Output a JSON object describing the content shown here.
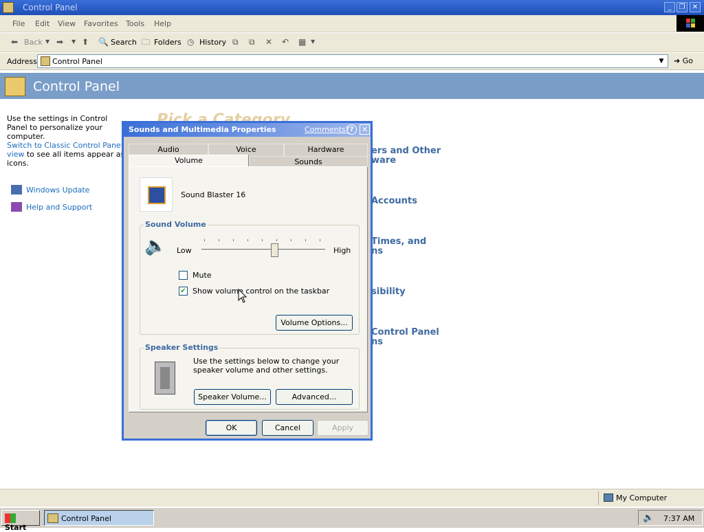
{
  "window": {
    "title": "Control Panel",
    "controls": [
      "minimize",
      "restore",
      "close"
    ]
  },
  "menubar": {
    "items": [
      "File",
      "Edit",
      "View",
      "Favorites",
      "Tools",
      "Help"
    ]
  },
  "toolbar": {
    "back_label": "Back",
    "search_label": "Search",
    "folders_label": "Folders",
    "history_label": "History"
  },
  "address": {
    "label": "Address",
    "value": "Control Panel",
    "go_label": "Go"
  },
  "header": {
    "title": "Control Panel"
  },
  "leftpane": {
    "intro": "Use the settings in Control Panel to personalize your computer.",
    "switch_link": "Switch to Classic Control Panel view",
    "switch_suffix": " to see all items appear as icons.",
    "links": [
      "Windows Update",
      "Help and Support"
    ]
  },
  "content": {
    "pick_heading": "Pick a Category",
    "categories": [
      {
        "line1": "ers and Other",
        "line2": "ware"
      },
      {
        "line1": "Accounts",
        "line2": ""
      },
      {
        "line1": "Times, and",
        "line2": "ns"
      },
      {
        "line1": "sibility",
        "line2": ""
      },
      {
        "line1": "Control Panel",
        "line2": "ns"
      }
    ]
  },
  "dialog": {
    "title": "Sounds and Multimedia Properties",
    "comments_link": "Comments?",
    "help_glyph": "?",
    "close_glyph": "✕",
    "tabs_row1": [
      "Audio",
      "Voice",
      "Hardware"
    ],
    "tabs_row2": [
      "Volume",
      "Sounds"
    ],
    "active_tab": "Volume",
    "device_name": "Sound Blaster 16",
    "sound_volume": {
      "group_label": "Sound Volume",
      "low_label": "Low",
      "high_label": "High",
      "level": 0.6,
      "mute_label": "Mute",
      "mute_checked": false,
      "show_taskbar_label": "Show volume control on the taskbar",
      "show_taskbar_checked": true,
      "volume_options_label": "Volume Options..."
    },
    "speaker_settings": {
      "group_label": "Speaker Settings",
      "description": "Use the settings below to change your speaker volume and other settings.",
      "speaker_volume_label": "Speaker Volume...",
      "advanced_label": "Advanced..."
    },
    "buttons": {
      "ok": "OK",
      "cancel": "Cancel",
      "apply": "Apply"
    }
  },
  "statusbar": {
    "zone": "My Computer"
  },
  "taskbar": {
    "start_label": "Start",
    "task_label": "Control Panel",
    "clock": "7:37 AM"
  },
  "colors": {
    "titlebar": "#1f4fb8",
    "header_band": "#7a9ec7",
    "link": "#1a6bbd",
    "group_label": "#3e6aa0",
    "dialog_face": "#d4d0c8"
  }
}
